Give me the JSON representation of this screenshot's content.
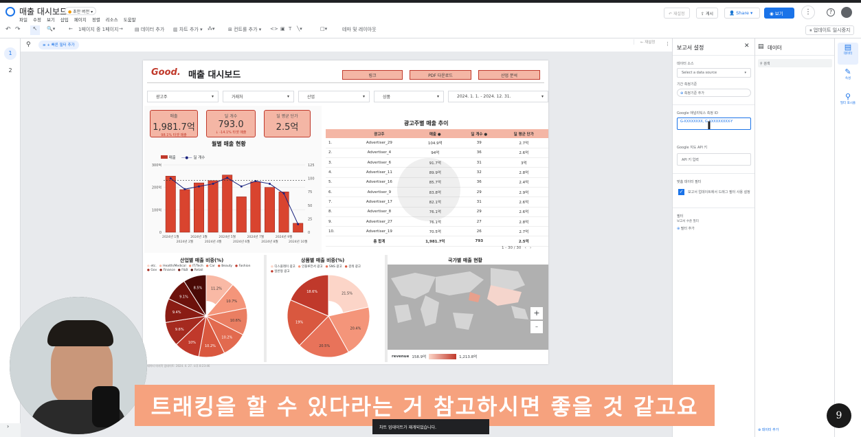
{
  "app": {
    "title": "매출 대시보드",
    "badge": "초안 버전",
    "menu": [
      "파일",
      "수정",
      "보기",
      "삽입",
      "페이지",
      "정렬",
      "리소스",
      "도움말"
    ],
    "header_buttons": {
      "reset": "재설정",
      "publish": "게시",
      "share": "Share",
      "view": "보기"
    }
  },
  "toolbar": {
    "page_nav": "1페이지 중 1페이지",
    "add_data": "데이터 추가",
    "add_chart": "차트 추가",
    "add_control": "컨트롤 추가",
    "theme": "테마 및 레이아웃",
    "refresh": "업데이트 일시중지"
  },
  "canvasbar": {
    "filter": "빠른 필터 추가",
    "reset": "재설정"
  },
  "pages": [
    "1",
    "2"
  ],
  "report": {
    "logo": "Good.",
    "title": "매출 대시보드",
    "buttons": [
      "링크",
      "PDF 다운로드",
      "산업 분석"
    ],
    "filters": [
      "광고주",
      "거래처",
      "산업",
      "상품",
      "2024. 1. 1. - 2024. 12. 31."
    ],
    "kpis": [
      {
        "label": "매출",
        "value": "1,981.7억",
        "sub": "98.1% 타겟 매출"
      },
      {
        "label": "딜 개수",
        "value": "793.0",
        "sub": "↓ -14.1% 타겟 매출"
      },
      {
        "label": "딜 평균 단가",
        "value": "2.5억",
        "sub": ""
      }
    ],
    "monthly_title": "월별 매출 현황",
    "legend": [
      "매출",
      "딜 개수"
    ],
    "table_title": "광고주별 매출 추이",
    "table_headers": [
      "광고주",
      "매출 ●",
      "딜 개수 ●",
      "딜 평균 단가"
    ],
    "table_rows": [
      [
        "1.",
        "Advertiser_29",
        "104.9억",
        "39",
        "2.7억"
      ],
      [
        "2.",
        "Advertiser_4",
        "94억",
        "36",
        "2.6억"
      ],
      [
        "3.",
        "Advertiser_6",
        "91.7억",
        "31",
        "3억"
      ],
      [
        "4.",
        "Advertiser_11",
        "89.9억",
        "32",
        "2.8억"
      ],
      [
        "5.",
        "Advertiser_16",
        "85.7억",
        "36",
        "2.4억"
      ],
      [
        "6.",
        "Advertiser_9",
        "83.8억",
        "29",
        "2.9억"
      ],
      [
        "7.",
        "Advertiser_17",
        "82.1억",
        "31",
        "2.6억"
      ],
      [
        "8.",
        "Advertiser_8",
        "76.1억",
        "29",
        "2.6억"
      ],
      [
        "9.",
        "Advertiser_27",
        "76.1억",
        "27",
        "2.8억"
      ],
      [
        "10.",
        "Advertiser_19",
        "70.5억",
        "26",
        "2.7억"
      ]
    ],
    "table_total": [
      "총 합계",
      "1,981.7억",
      "793",
      "2.5억"
    ],
    "table_pager": "1 - 30 / 30",
    "industry_title": "산업별 매출 비중(%)",
    "industry_legend": [
      "etc.",
      "Health/Medical",
      "IT/Tech",
      "Car",
      "Beauty",
      "Fashion",
      "Gov",
      "Finance",
      "F&B",
      "Retail"
    ],
    "product_title": "상품별 매출 비중(%)",
    "product_legend": [
      "디스플레이 광고",
      "인플루언서 광고",
      "SNS 광고",
      "검색 광고",
      "일반형 광고"
    ],
    "geo_title": "국가별 매출 현황",
    "geo_legend": [
      "revenue",
      "158.9억",
      "1,213.8억"
    ],
    "footer": "데이터 마지막 업데이트: 2024. 4. 27. 오후 8:23:46"
  },
  "chart_data": [
    {
      "type": "bar",
      "title": "월별 매출 현황",
      "categories": [
        "2024년 1월",
        "2024년 2월",
        "2024년 3월",
        "2024년 4월",
        "2024년 5월",
        "2024년 6월",
        "2024년 7월",
        "2024년 8월",
        "2024년 9월",
        "2024년 10월"
      ],
      "x_tick_labels": [
        "2024년 1월",
        "2024년 2월",
        "2024년 3월",
        "2024년 4월",
        "2024년 5월",
        "2024년 6월",
        "2024년 7월",
        "2024년 8월",
        "2024년 9월",
        "2024년 10월"
      ],
      "series": [
        {
          "name": "매출",
          "type": "bar",
          "axis": "left",
          "values": [
            250,
            190,
            220,
            230,
            255,
            158,
            225,
            200,
            180,
            40
          ]
        },
        {
          "name": "딜 개수",
          "type": "line",
          "axis": "right",
          "values": [
            100,
            80,
            85,
            90,
            101,
            85,
            95,
            90,
            72,
            15
          ]
        }
      ],
      "ylim": [
        0,
        300
      ],
      "y2lim": [
        0,
        125
      ],
      "y_ticks": [
        "0",
        "100억",
        "200억",
        "300억"
      ],
      "y2_ticks": [
        "0",
        "25",
        "50",
        "75",
        "100",
        "125"
      ]
    },
    {
      "type": "pie",
      "title": "산업별 매출 비중(%)",
      "labels": [
        "etc.",
        "Health/Medical",
        "IT/Tech",
        "Car",
        "Beauty",
        "Fashion",
        "Gov",
        "Finance",
        "F&B",
        "Retail"
      ],
      "values": [
        11.2,
        10.7,
        10.6,
        10.2,
        10.2,
        10,
        9.6,
        9.4,
        9.1,
        9.0
      ],
      "label_texts": [
        "11.2%",
        "10.7%",
        "10.6%",
        "10.2%",
        "10.2%",
        "10%",
        "9.6%",
        "9.4%",
        "9.1%",
        "8.5%"
      ]
    },
    {
      "type": "pie",
      "title": "상품별 매출 비중(%)",
      "labels": [
        "디스플레이 광고",
        "인플루언서 광고",
        "SNS 광고",
        "검색 광고",
        "일반형 광고"
      ],
      "values": [
        21.5,
        20.4,
        20.5,
        19,
        18.6
      ],
      "label_texts": [
        "21.5%",
        "20.4%",
        "20.5%",
        "19%",
        "18.6%"
      ]
    }
  ],
  "right_panel": {
    "title": "보고서 설정",
    "data_source_label": "데이터 소스",
    "data_source_value": "Select a data source",
    "filter_label": "기간 측정기준",
    "filter_add": "측정기준 추가",
    "ga_label": "Google 애널리틱스 측정 ID",
    "ga_value": "G-XXXXXXXX, G-XXXXXXXXX-Y",
    "maps_label": "Google 지도 API 키",
    "maps_placeholder": "API 키 입력",
    "crossfilter_label": "맞춤 데이터 필터",
    "crossfilter_text": "보고서 업데이트에서 드래그 필터 사용 설정",
    "filter2_label": "필터",
    "filter2_sub": "보고서 수준 필터",
    "filter2_add": "필터 추가"
  },
  "data_panel": {
    "title": "데이터",
    "search": "검색",
    "add": "데이터 추가"
  },
  "rail": [
    "데이터",
    "속성",
    "필터 표시줄"
  ],
  "caption": "트래킹을 할 수 있다라는 거 참고하시면 좋을 것 같고요",
  "toast": "차트 업데이트가 재개되었습니다.",
  "colors": {
    "accent": "#c0392b",
    "pink": "#f4b6a5",
    "blue": "#1a73e8",
    "caption": "#f6a27e"
  }
}
